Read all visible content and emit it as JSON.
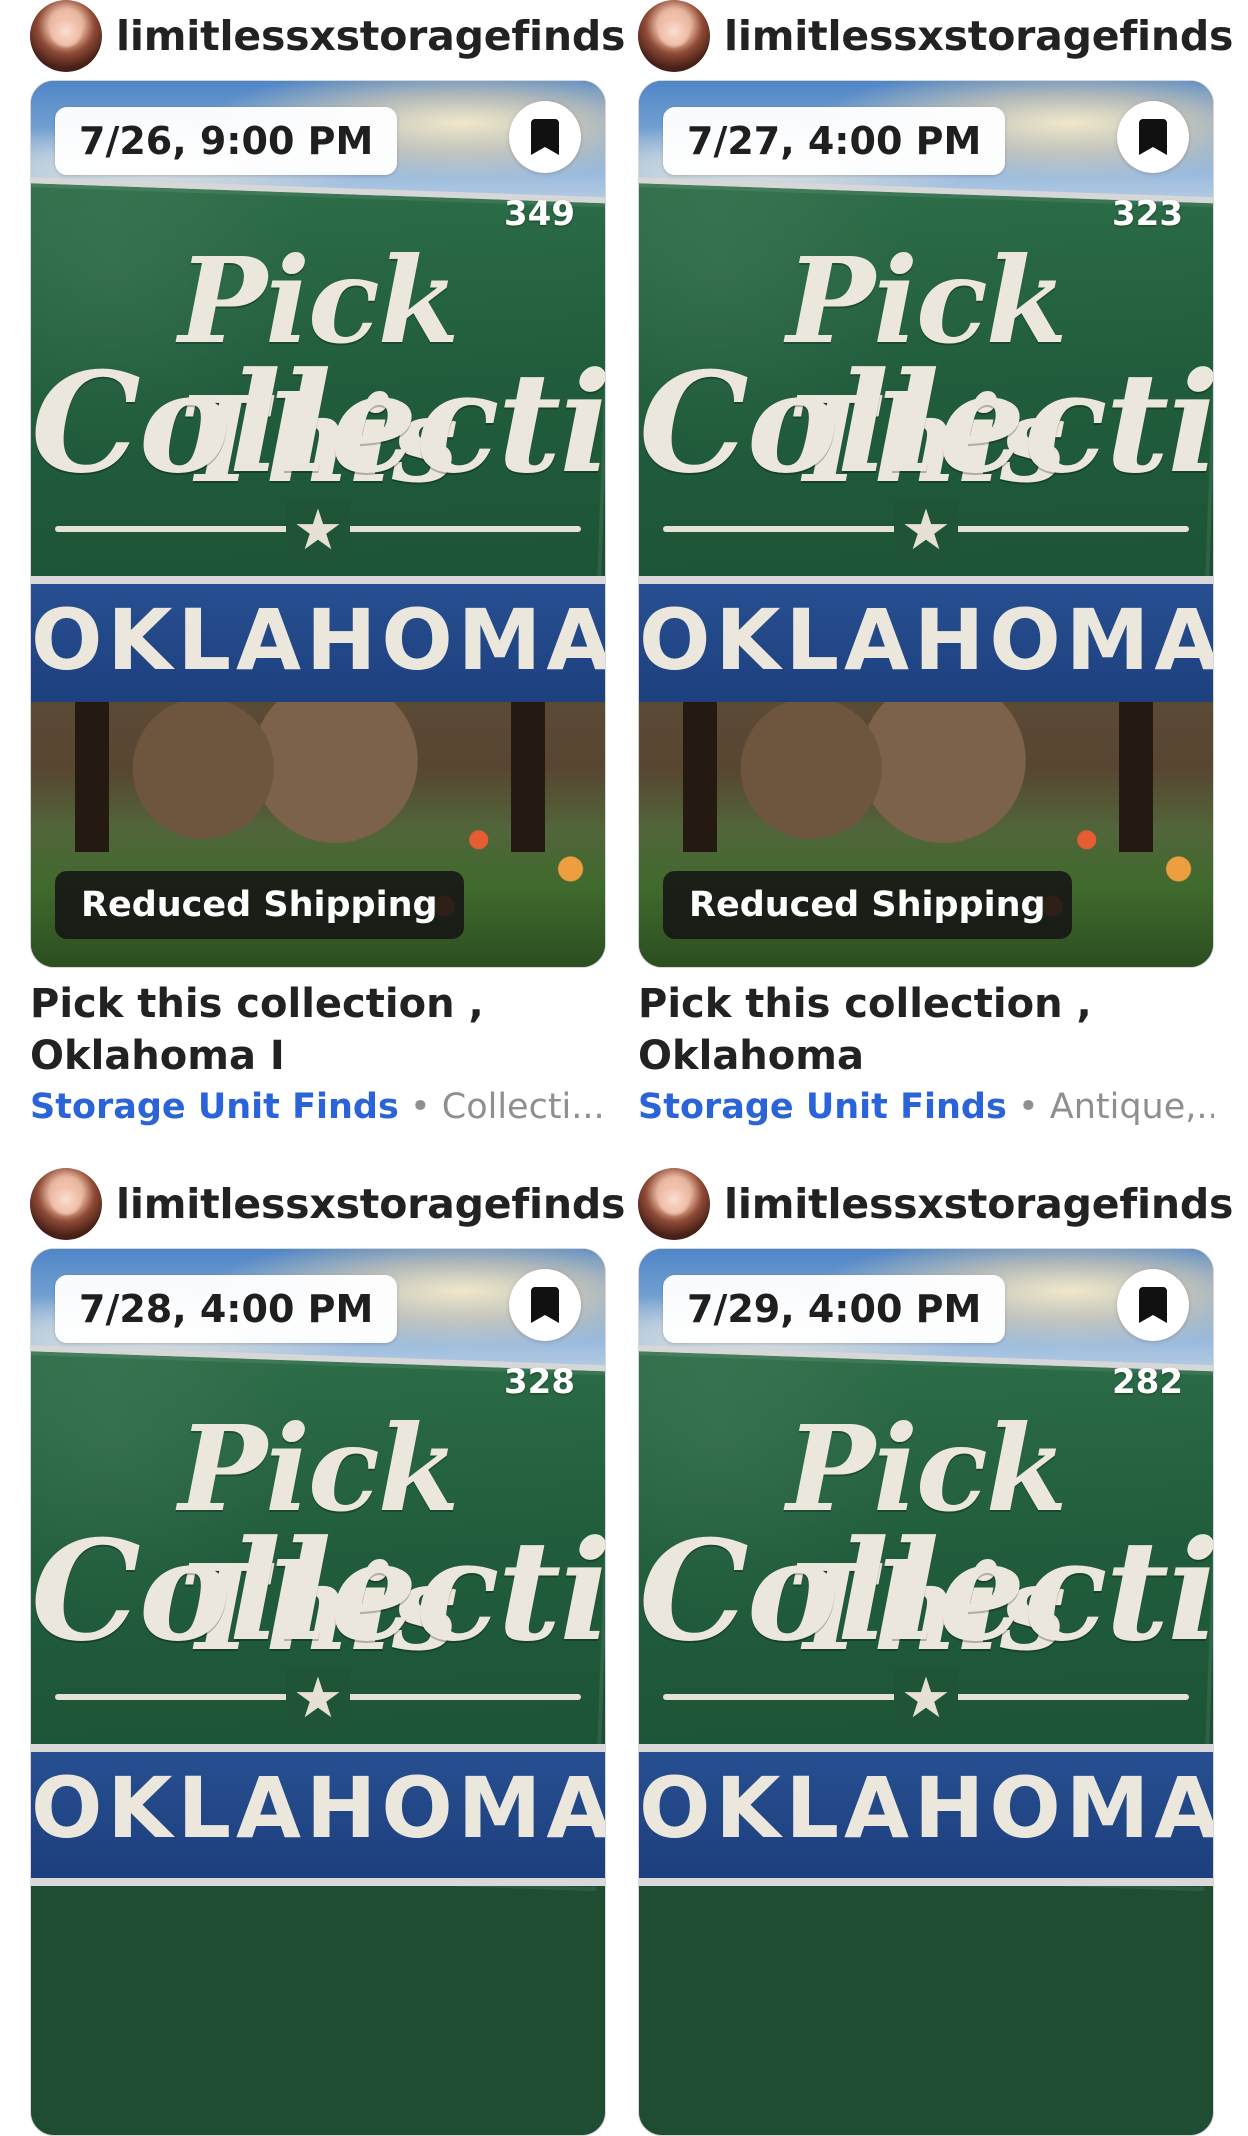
{
  "colors": {
    "category_link": "#2b63d8",
    "meta_gray": "#8f8f8f",
    "sign_green": "#205c3b",
    "sign_blue": "#1d3f7d"
  },
  "cards": [
    {
      "seller": "limitlessxstoragefinds",
      "date": "7/26, 9:00 PM",
      "watch_count": "349",
      "shipping_badge": "Reduced Shipping",
      "title": "Pick this collection , Oklahoma I",
      "category": "Storage Unit Finds",
      "separator": "•",
      "extra": "Collecti...",
      "sign_line_1": "Pick This",
      "sign_line_2": "Collection",
      "sign_band": "OKLAHOMA",
      "icons": {
        "avatar": "avatar",
        "watch": "bookmark-icon",
        "star": "star-icon"
      }
    },
    {
      "seller": "limitlessxstoragefinds",
      "date": "7/27, 4:00 PM",
      "watch_count": "323",
      "shipping_badge": "Reduced Shipping",
      "title": "Pick this collection , Oklahoma",
      "category": "Storage Unit Finds",
      "separator": "•",
      "extra": "Antique,...",
      "sign_line_1": "Pick This",
      "sign_line_2": "Collection",
      "sign_band": "OKLAHOMA",
      "icons": {
        "avatar": "avatar",
        "watch": "bookmark-icon",
        "star": "star-icon"
      }
    },
    {
      "seller": "limitlessxstoragefinds",
      "date": "7/28, 4:00 PM",
      "watch_count": "328",
      "sign_line_1": "Pick This",
      "sign_line_2": "Collection",
      "sign_band": "OKLAHOMA",
      "icons": {
        "avatar": "avatar",
        "watch": "bookmark-icon",
        "star": "star-icon"
      }
    },
    {
      "seller": "limitlessxstoragefinds",
      "date": "7/29, 4:00 PM",
      "watch_count": "282",
      "sign_line_1": "Pick This",
      "sign_line_2": "Collection",
      "sign_band": "OKLAHOMA",
      "icons": {
        "avatar": "avatar",
        "watch": "bookmark-icon",
        "star": "star-icon"
      }
    }
  ]
}
